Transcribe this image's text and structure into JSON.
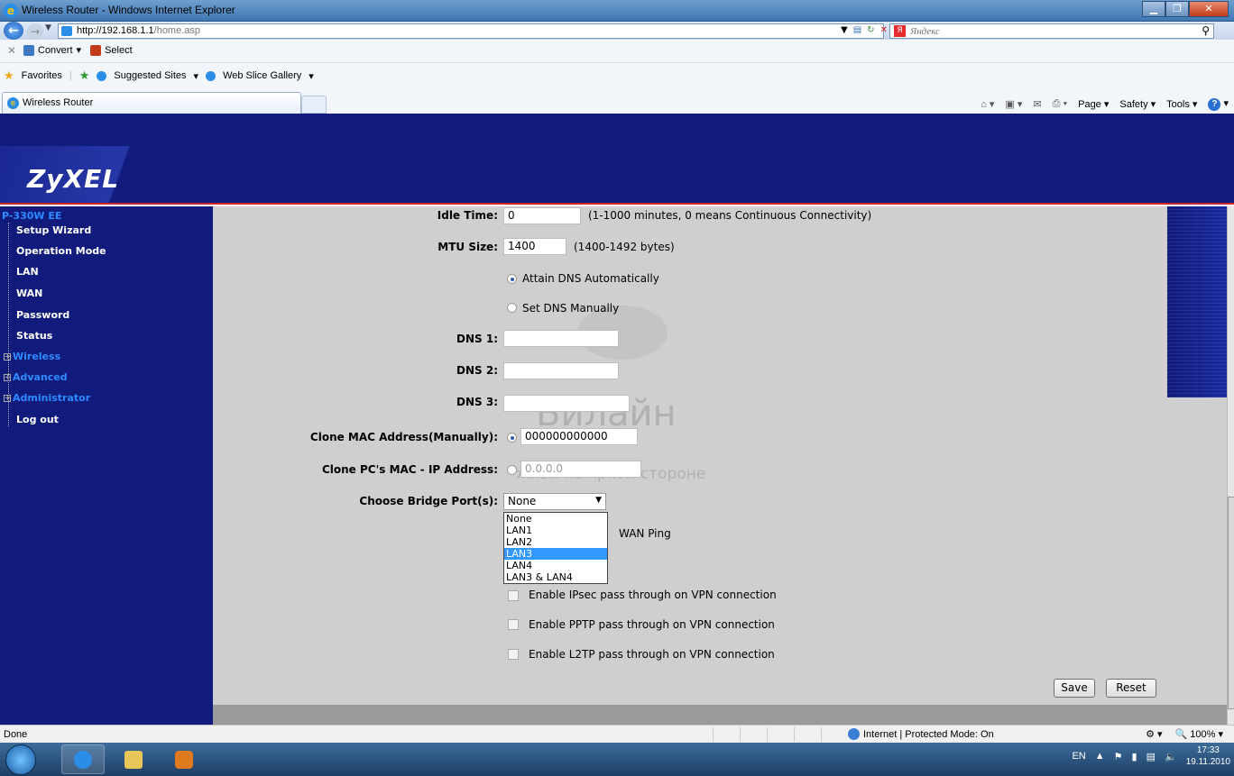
{
  "window": {
    "title": "Wireless Router - Windows Internet Explorer"
  },
  "address": {
    "url_host": "http://192.168.1.1",
    "url_path": "/home.asp",
    "search_placeholder": "Яндекс"
  },
  "commandbar": {
    "convert": "Convert",
    "select": "Select"
  },
  "favorites": {
    "favorites": "Favorites",
    "suggested": "Suggested Sites",
    "webslice": "Web Slice Gallery",
    "tab_title": "Wireless Router",
    "page": "Page",
    "safety": "Safety",
    "tools": "Tools"
  },
  "router": {
    "logo": "ZyXEL",
    "model": "P-330W EE",
    "menu": [
      {
        "label": "Setup Wizard"
      },
      {
        "label": "Operation Mode"
      },
      {
        "label": "LAN"
      },
      {
        "label": "WAN"
      },
      {
        "label": "Password"
      },
      {
        "label": "Status"
      },
      {
        "label": "Wireless"
      },
      {
        "label": "Advanced"
      },
      {
        "label": "Administrator"
      },
      {
        "label": "Log out"
      }
    ]
  },
  "form": {
    "idle_label": "Idle Time:",
    "idle_value": "0",
    "idle_hint": "(1-1000 minutes, 0 means Continuous Connectivity)",
    "mtu_label": "MTU Size:",
    "mtu_value": "1400",
    "mtu_hint": "(1400-1492 bytes)",
    "dns_auto": "Attain DNS Automatically",
    "dns_manual": "Set DNS Manually",
    "dns1_label": "DNS 1:",
    "dns2_label": "DNS 2:",
    "dns3_label": "DNS 3:",
    "clone_mac_label": "Clone MAC Address(Manually):",
    "clone_mac_value": "000000000000",
    "clone_pc_label": "Clone PC's MAC - IP Address:",
    "clone_pc_value": "0.0.0.0",
    "bridge_label": "Choose Bridge Port(s):",
    "bridge_value": "None",
    "bridge_options": [
      "None",
      "LAN1",
      "LAN2",
      "LAN3",
      "LAN4",
      "LAN3 & LAN4"
    ],
    "wan_ping_partial": "WAN Ping",
    "ipsec": "Enable IPsec pass through on VPN connection",
    "pptp": "Enable PPTP pass through on VPN connection",
    "l2tp": "Enable L2TP pass through on VPN connection",
    "save": "Save",
    "reset": "Reset"
  },
  "watermark": {
    "brand": "Билайн",
    "tagline": "живи на яркой стороне"
  },
  "status": {
    "done": "Done",
    "zone": "Internet | Protected Mode: On",
    "zoom": "100%"
  },
  "taskbar": {
    "lang": "EN",
    "time": "17:33",
    "date": "19.11.2010"
  },
  "colors": {
    "router_navy": "#111b7b",
    "accent_red": "#c8262b",
    "selection_blue": "#3399ff"
  }
}
